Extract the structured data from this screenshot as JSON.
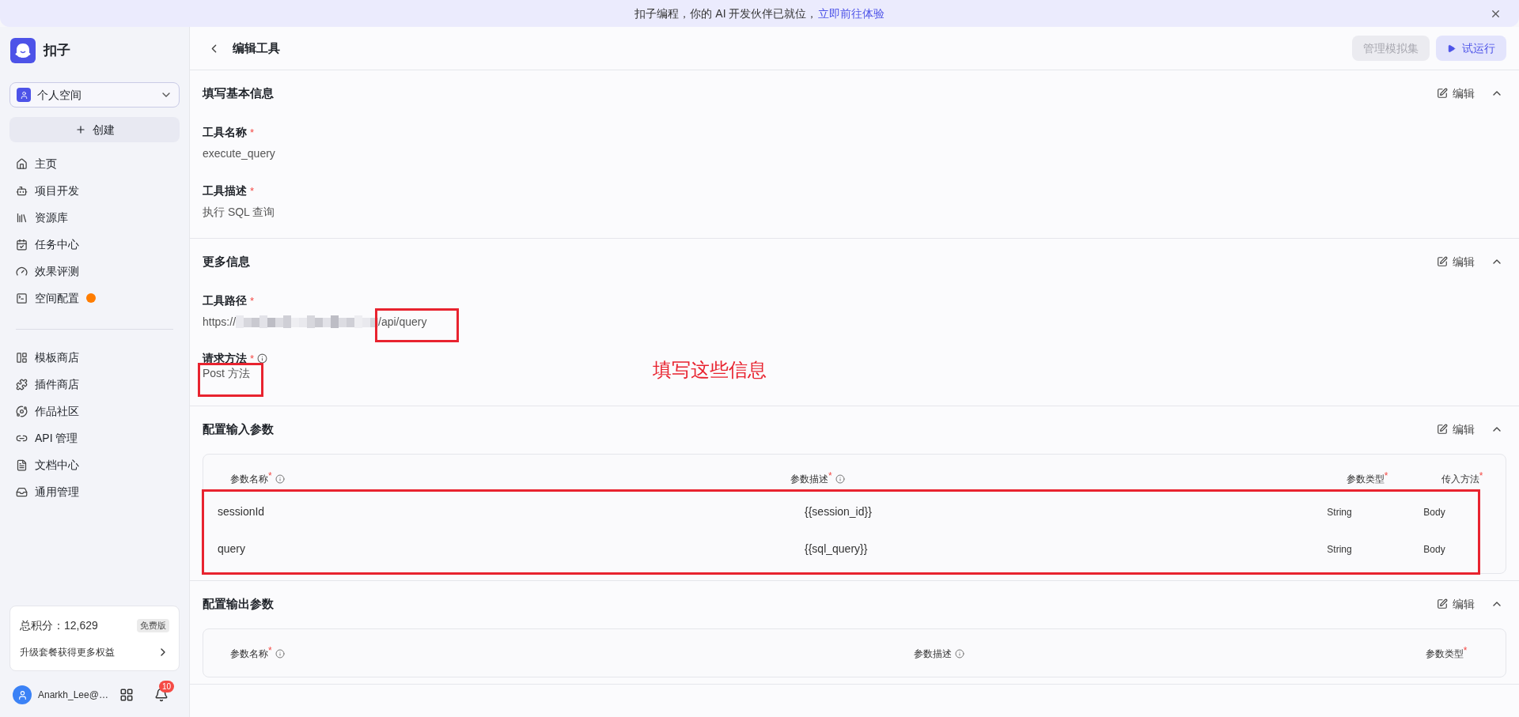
{
  "banner": {
    "text": "扣子编程，你的 AI 开发伙伴已就位，",
    "link": "立即前往体验"
  },
  "sidebar": {
    "brand": "扣子",
    "space": "个人空间",
    "create_button": "创建",
    "nav_groups": [
      [
        {
          "label": "主页",
          "alert": false
        },
        {
          "label": "项目开发",
          "alert": false
        },
        {
          "label": "资源库",
          "alert": false
        },
        {
          "label": "任务中心",
          "alert": false
        },
        {
          "label": "效果评测",
          "alert": false
        },
        {
          "label": "空间配置",
          "alert": true
        }
      ],
      [
        {
          "label": "模板商店",
          "alert": false
        },
        {
          "label": "插件商店",
          "alert": false
        },
        {
          "label": "作品社区",
          "alert": false
        },
        {
          "label": "API 管理",
          "alert": false
        },
        {
          "label": "文档中心",
          "alert": false
        },
        {
          "label": "通用管理",
          "alert": false
        }
      ]
    ],
    "points": {
      "label": "总积分：12,629",
      "plan": "免费版",
      "upgrade": "升级套餐获得更多权益"
    },
    "user": {
      "name": "Anarkh_Lee@…",
      "notifications": "10"
    }
  },
  "header": {
    "title": "编辑工具",
    "buttons": [
      {
        "label": "管理模拟集",
        "disabled": true,
        "kind": "plain"
      },
      {
        "label": "试运行",
        "disabled": false,
        "kind": "run"
      }
    ]
  },
  "sections": [
    {
      "title": "填写基本信息",
      "edit": "编辑",
      "expanded": true,
      "kind": "fields",
      "fields": [
        {
          "label": "工具名称",
          "required_mark": "*",
          "info": false,
          "kind": "text",
          "value": "execute_query",
          "annotated": false
        },
        {
          "label": "工具描述",
          "required_mark": "*",
          "info": false,
          "kind": "text",
          "value": "执行 SQL 查询",
          "annotated": false
        }
      ]
    },
    {
      "title": "更多信息",
      "edit": "编辑",
      "expanded": true,
      "kind": "fields",
      "annotation": "填写这些信息",
      "fields": [
        {
          "label": "工具路径",
          "required_mark": "*",
          "info": false,
          "kind": "url",
          "prefix": "https://",
          "suffix": "/api/query",
          "annotated": true
        },
        {
          "label": "请求方法",
          "required_mark": "*",
          "info": true,
          "kind": "text",
          "value": "Post 方法",
          "annotated": true
        }
      ]
    },
    {
      "title": "配置输入参数",
      "edit": "编辑",
      "expanded": true,
      "kind": "params",
      "rows_annotated": true,
      "columns": [
        {
          "label": "参数名称",
          "required_mark": "*",
          "info": true
        },
        {
          "label": "参数描述",
          "required_mark": "*",
          "info": true
        },
        {
          "label": "参数类型",
          "required_mark": "*",
          "info": false
        },
        {
          "label": "传入方法",
          "required_mark": "*",
          "info": false
        }
      ],
      "rows": [
        [
          "sessionId",
          "{{session_id}}",
          "String",
          "Body"
        ],
        [
          "query",
          "{{sql_query}}",
          "String",
          "Body"
        ]
      ]
    },
    {
      "title": "配置输出参数",
      "edit": "编辑",
      "expanded": true,
      "kind": "params",
      "rows_annotated": false,
      "columns": [
        {
          "label": "参数名称",
          "required_mark": "*",
          "info": true
        },
        {
          "label": "参数描述",
          "info": true
        },
        {
          "label": "参数类型",
          "required_mark": "*",
          "info": false
        }
      ]
    }
  ]
}
